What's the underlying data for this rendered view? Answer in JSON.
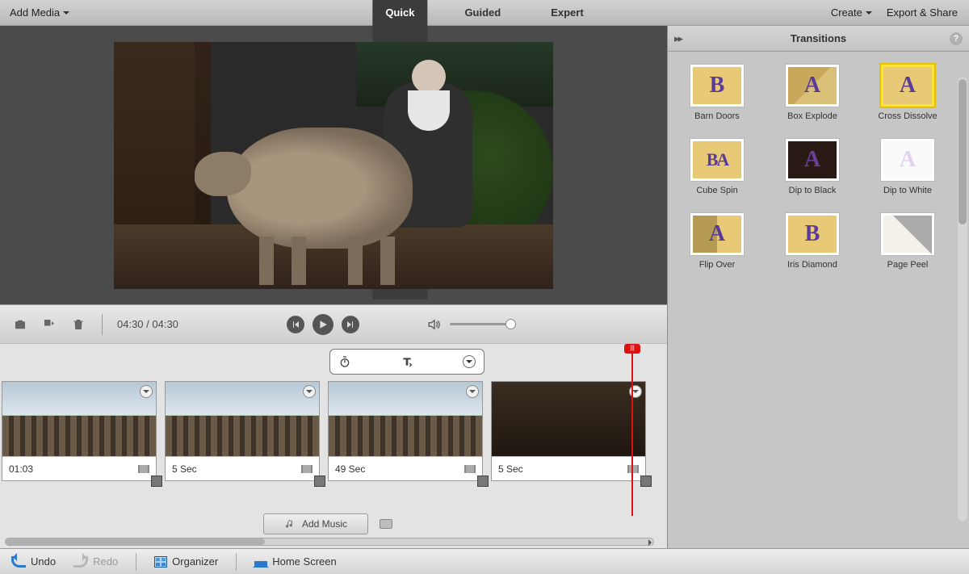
{
  "topbar": {
    "add_media": "Add Media",
    "tabs": {
      "quick": "Quick",
      "guided": "Guided",
      "expert": "Expert"
    },
    "create": "Create",
    "export": "Export & Share"
  },
  "controls": {
    "time": "04:30 / 04:30"
  },
  "timeline": {
    "clips": [
      {
        "duration": "01:03"
      },
      {
        "duration": "5 Sec"
      },
      {
        "duration": "49 Sec"
      },
      {
        "duration": "5 Sec"
      }
    ],
    "add_music": "Add Music"
  },
  "panel": {
    "title": "Transitions",
    "items": [
      {
        "label": "Barn Doors",
        "glyph": "B",
        "cls": ""
      },
      {
        "label": "Box Explode",
        "glyph": "A",
        "cls": "box3d"
      },
      {
        "label": "Cross Dissolve",
        "glyph": "A",
        "cls": "",
        "selected": true
      },
      {
        "label": "Cube Spin",
        "glyph": "BA",
        "cls": "double"
      },
      {
        "label": "Dip to Black",
        "glyph": "A",
        "cls": "dark"
      },
      {
        "label": "Dip to White",
        "glyph": "A",
        "cls": "white"
      },
      {
        "label": "Flip Over",
        "glyph": "A",
        "cls": "split"
      },
      {
        "label": "Iris Diamond",
        "glyph": "B",
        "cls": ""
      },
      {
        "label": "Page Peel",
        "glyph": "",
        "cls": "peel"
      }
    ]
  },
  "bottombar": {
    "undo": "Undo",
    "redo": "Redo",
    "organizer": "Organizer",
    "home": "Home Screen"
  }
}
